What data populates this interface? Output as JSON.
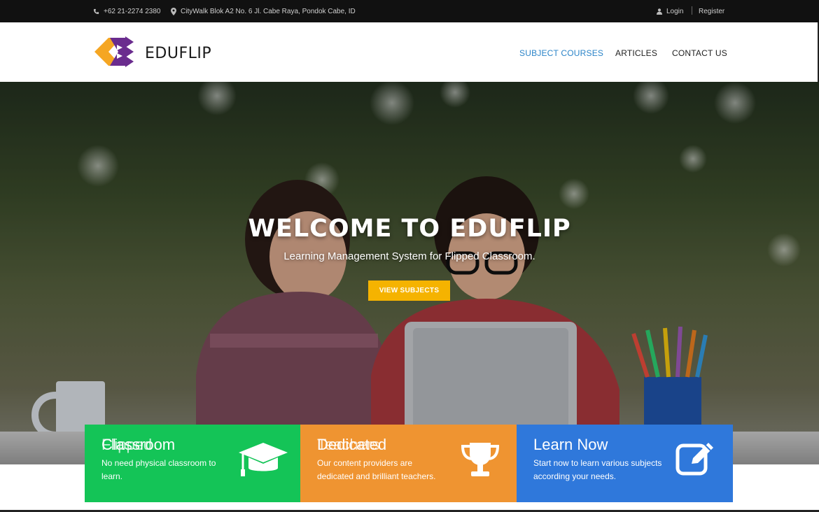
{
  "topbar": {
    "phone": "+62 21-2274 2380",
    "address": "CityWalk Blok A2 No. 6 Jl. Cabe Raya, Pondok Cabe, ID",
    "login": "Login",
    "register": "Register"
  },
  "header": {
    "logo_text": "EDUFLIP",
    "nav": [
      {
        "label": "SUBJECT COURSES"
      },
      {
        "label": "ARTICLES"
      },
      {
        "label": "CONTACT US"
      }
    ]
  },
  "hero": {
    "title": "WELCOME TO EDUFLIP",
    "subtitle": "Learning Management System for Flipped Classroom.",
    "button": "VIEW SUBJECTS"
  },
  "features": [
    {
      "title": "Classroom",
      "title_overlap": "Flipped",
      "desc": "No need physical classroom to learn.",
      "icon": "graduation-cap-icon",
      "color": "#14c457"
    },
    {
      "title": "Dedicated",
      "title_overlap": "Teachers",
      "desc": "Our content providers are dedicated and brilliant teachers.",
      "icon": "trophy-icon",
      "color": "#ef9431"
    },
    {
      "title": "Learn Now",
      "title_overlap": "",
      "desc": "Start now to learn various subjects according your needs.",
      "icon": "edit-icon",
      "color": "#2f78db"
    }
  ],
  "colors": {
    "accent": "#2b84c8",
    "button": "#f5b300"
  }
}
